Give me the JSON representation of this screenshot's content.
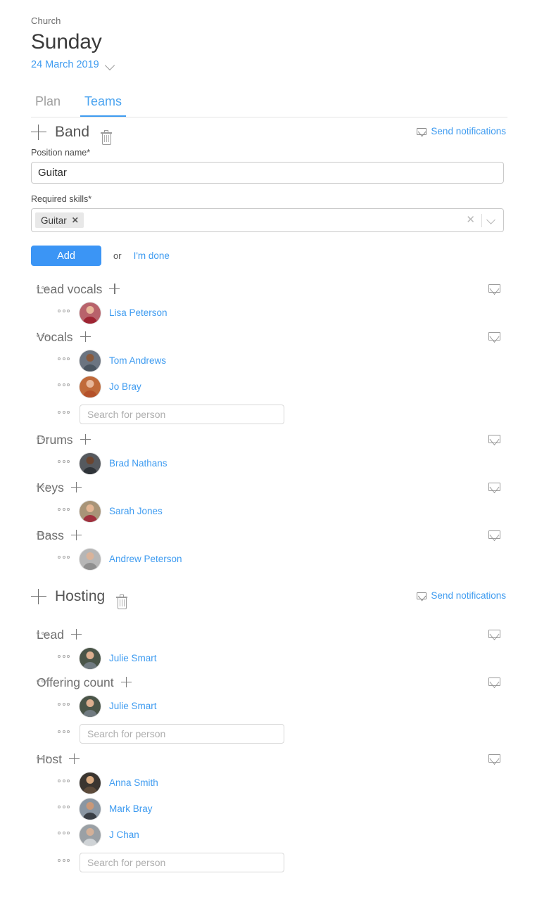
{
  "header": {
    "breadcrumb": "Church",
    "title": "Sunday",
    "date": "24 March 2019",
    "date_chevron_icon": "chevron-down-icon"
  },
  "tabs": [
    {
      "label": "Plan",
      "active": false
    },
    {
      "label": "Teams",
      "active": true
    }
  ],
  "form": {
    "position_name_label": "Position name*",
    "position_name_value": "Guitar",
    "required_skills_label": "Required skills*",
    "skill_chips": [
      {
        "label": "Guitar",
        "remove_icon": "close-icon"
      }
    ],
    "clear_icon": "clear-icon",
    "dropdown_icon": "chevron-down-icon",
    "add_button": "Add",
    "or_text": "or",
    "done_link": "I'm done"
  },
  "icons": {
    "add": "plus-icon",
    "delete": "trash-icon",
    "mail": "envelope-icon",
    "drag": "drag-handle-icon"
  },
  "search_placeholder": "Search for person",
  "send_notifications_label": "Send notifications",
  "colors": {
    "accent": "#3b95f5",
    "link": "#3e9bf0",
    "text": "#333333",
    "muted": "#9e9e9e",
    "border": "#c9c9c9"
  },
  "teams": [
    {
      "name": "Band",
      "send_notifications": "Send notifications",
      "positions": [
        {
          "name": "Lead vocals",
          "people": [
            {
              "name": "Lisa Peterson",
              "avatar_bg": "#b8626b",
              "skin": "#e8b79a",
              "cloth": "#9e2432"
            }
          ],
          "show_search": false
        },
        {
          "name": "Vocals",
          "people": [
            {
              "name": "Tom Andrews",
              "avatar_bg": "#6b7480",
              "skin": "#8a5a3c",
              "cloth": "#4a5560"
            },
            {
              "name": "Jo Bray",
              "avatar_bg": "#c06a3a",
              "skin": "#e8b79a",
              "cloth": "#b4512a"
            }
          ],
          "show_search": true
        },
        {
          "name": "Drums",
          "people": [
            {
              "name": "Brad Nathans",
              "avatar_bg": "#55595e",
              "skin": "#6b4530",
              "cloth": "#2e3338"
            }
          ],
          "show_search": false
        },
        {
          "name": "Keys",
          "people": [
            {
              "name": "Sarah Jones",
              "avatar_bg": "#a89478",
              "skin": "#e3b594",
              "cloth": "#a0303e"
            }
          ],
          "show_search": false
        },
        {
          "name": "Bass",
          "people": [
            {
              "name": "Andrew Peterson",
              "avatar_bg": "#b6b6b6",
              "skin": "#d9b39a",
              "cloth": "#8f8f8f"
            }
          ],
          "show_search": false
        }
      ]
    },
    {
      "name": "Hosting",
      "send_notifications": "Send notifications",
      "positions": [
        {
          "name": "Lead",
          "people": [
            {
              "name": "Julie Smart",
              "avatar_bg": "#4a5548",
              "skin": "#dcae8e",
              "cloth": "#707a80"
            }
          ],
          "show_search": false
        },
        {
          "name": "Offering count",
          "people": [
            {
              "name": "Julie Smart",
              "avatar_bg": "#4a5548",
              "skin": "#dcae8e",
              "cloth": "#707a80"
            }
          ],
          "show_search": true
        },
        {
          "name": "Host",
          "people": [
            {
              "name": "Anna Smith",
              "avatar_bg": "#3a3530",
              "skin": "#d8a97f",
              "cloth": "#5c4a3a"
            },
            {
              "name": "Mark Bray",
              "avatar_bg": "#8a96a2",
              "skin": "#c99878",
              "cloth": "#3a3f45"
            },
            {
              "name": "J Chan",
              "avatar_bg": "#9aa0a5",
              "skin": "#d3b098",
              "cloth": "#cfd3d6"
            }
          ],
          "show_search": true
        }
      ]
    }
  ]
}
